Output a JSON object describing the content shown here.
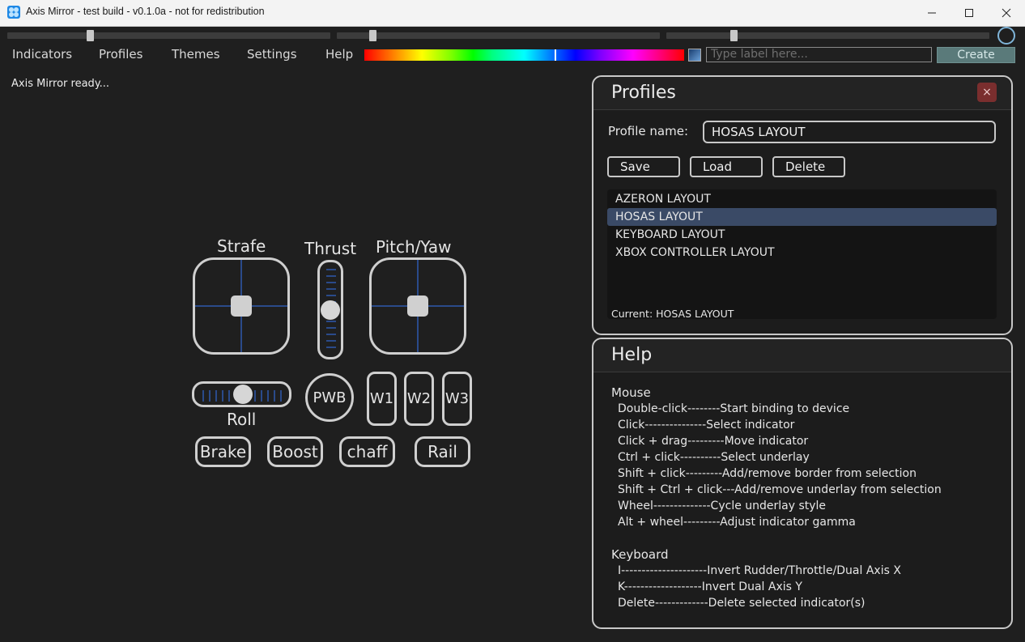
{
  "window": {
    "title": "Axis Mirror - test build - v0.1.0a - not for redistribution"
  },
  "menu": {
    "items": [
      "Indicators",
      "Profiles",
      "Themes",
      "Settings",
      "Help"
    ],
    "label_placeholder": "Type label here...",
    "create_label": "Create"
  },
  "status": "Axis Mirror ready...",
  "controls": {
    "strafe": "Strafe",
    "thrust": "Thrust",
    "pitch_yaw": "Pitch/Yaw",
    "roll": "Roll",
    "pwb": "PWB",
    "w1": "W1",
    "w2": "W2",
    "w3": "W3",
    "brake": "Brake",
    "boost": "Boost",
    "chaff": "chaff",
    "rail": "Rail"
  },
  "profiles": {
    "title": "Profiles",
    "close": "×",
    "name_label": "Profile name:",
    "name_value": "HOSAS LAYOUT",
    "buttons": {
      "save": "Save",
      "load": "Load",
      "delete": "Delete"
    },
    "items": [
      "AZERON LAYOUT",
      "HOSAS LAYOUT",
      "KEYBOARD LAYOUT",
      "XBOX CONTROLLER LAYOUT"
    ],
    "selected_index": 1,
    "current": "Current: HOSAS LAYOUT"
  },
  "help": {
    "title": "Help",
    "mouse_heading": "Mouse",
    "mouse_lines": [
      "Double-click--------Start binding to device",
      "Click---------------Select indicator",
      "Click + drag---------Move indicator",
      "Ctrl + click----------Select underlay",
      "Shift + click---------Add/remove border from selection",
      "Shift + Ctrl + click---Add/remove underlay from selection",
      "Wheel--------------Cycle underlay style",
      "Alt + wheel---------Adjust indicator gamma"
    ],
    "keyboard_heading": "Keyboard",
    "keyboard_lines": [
      "I---------------------Invert Rudder/Throttle/Dual Axis X",
      "K-------------------Invert Dual Axis Y",
      "Delete-------------Delete selected indicator(s)"
    ]
  },
  "colors": {
    "accent_blue": "#2a4a8a",
    "selection": "#3a4a66",
    "close_button": "#7a2e2e",
    "create_button": "#5a7a7a"
  }
}
